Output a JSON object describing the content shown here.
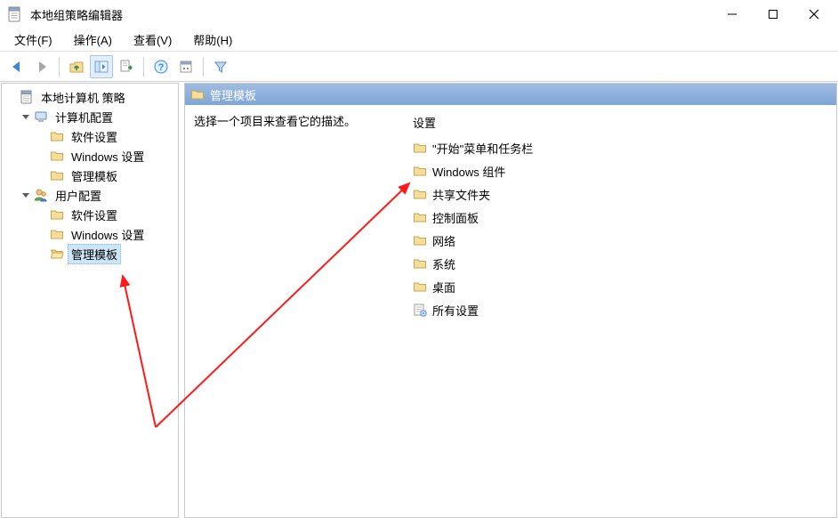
{
  "window": {
    "title": "本地组策略编辑器"
  },
  "menu": {
    "file": "文件(F)",
    "action": "操作(A)",
    "view": "查看(V)",
    "help": "帮助(H)"
  },
  "tree": {
    "root": "本地计算机 策略",
    "computer": "计算机配置",
    "user": "用户配置",
    "software": "软件设置",
    "windows_settings": "Windows 设置",
    "admin_templates": "管理模板"
  },
  "detail": {
    "header": "管理模板",
    "prompt": "选择一个项目来查看它的描述。",
    "column_header": "设置",
    "items": [
      "\"开始\"菜单和任务栏",
      "Windows 组件",
      "共享文件夹",
      "控制面板",
      "网络",
      "系统",
      "桌面",
      "所有设置"
    ]
  }
}
